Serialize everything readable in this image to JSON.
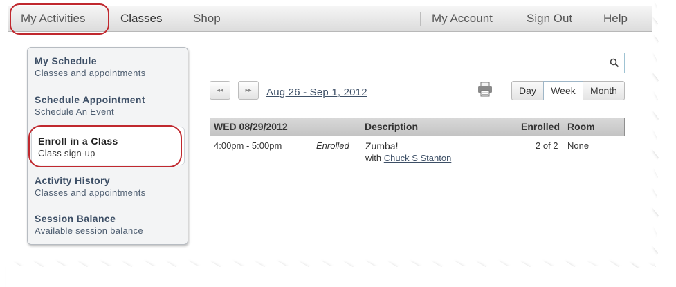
{
  "nav": {
    "my_activities": "My Activities",
    "classes": "Classes",
    "shop": "Shop",
    "my_account": "My Account",
    "sign_out": "Sign Out",
    "help": "Help"
  },
  "sidebar": {
    "items": [
      {
        "title": "My Schedule",
        "subtitle": "Classes and appointments"
      },
      {
        "title": "Schedule Appointment",
        "subtitle": "Schedule An Event"
      },
      {
        "title": "Enroll in a Class",
        "subtitle": "Class sign-up"
      },
      {
        "title": "Activity History",
        "subtitle": "Classes and appointments"
      },
      {
        "title": "Session Balance",
        "subtitle": "Available session balance"
      }
    ]
  },
  "search": {
    "placeholder": "",
    "value": "",
    "icon": "search-icon"
  },
  "calendar": {
    "prev_label": "◂◂",
    "next_label": "▸▸",
    "date_range": "Aug 26 - Sep 1, 2012",
    "views": [
      "Day",
      "Week",
      "Month"
    ],
    "active_view": "Week"
  },
  "table": {
    "day_header": "WED  08/29/2012",
    "columns": {
      "description": "Description",
      "enrolled": "Enrolled",
      "room": "Room"
    },
    "rows": [
      {
        "time": "4:00pm - 5:00pm",
        "status": "Enrolled",
        "description": "Zumba!",
        "with_prefix": "with",
        "instructor": "Chuck S Stanton",
        "enrolled": "2 of 2",
        "room": "None"
      }
    ]
  },
  "colors": {
    "highlight_circle": "#c0282e",
    "link": "#3d4f66"
  }
}
